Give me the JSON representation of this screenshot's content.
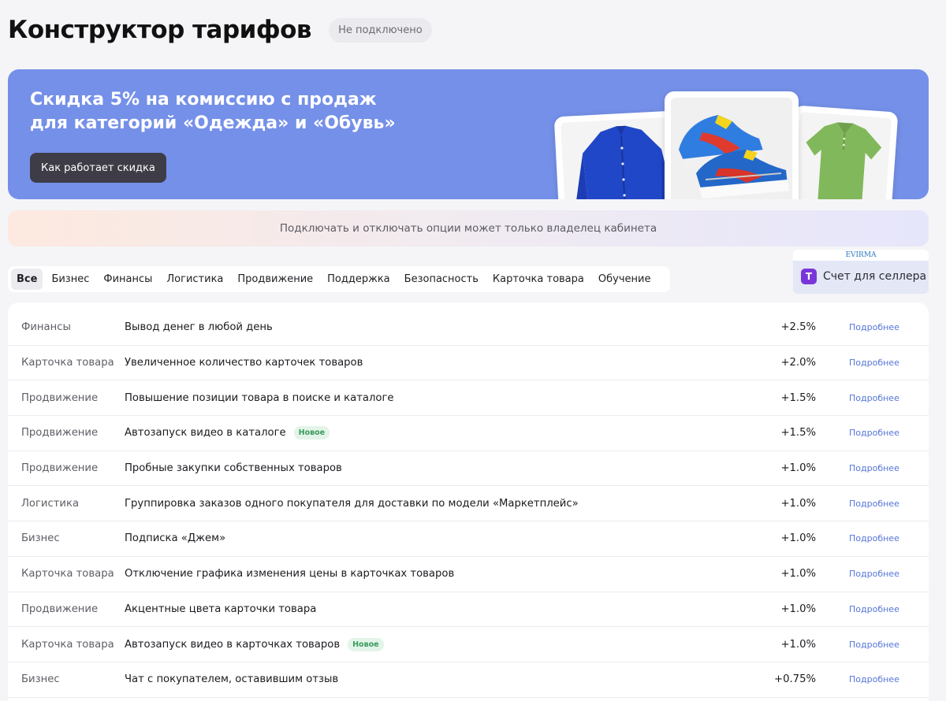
{
  "header": {
    "title": "Конструктор тарифов",
    "status": "Не подключено"
  },
  "banner": {
    "title_line1": "Скидка 5% на комиссию с продаж",
    "title_line2": "для категорий «Одежда» и «Обувь»",
    "button_label": "Как работает скидка",
    "background_color": "#7590e8"
  },
  "notice": {
    "text": "Подключать и отключать опции может только владелец кабинета"
  },
  "tabs": [
    {
      "label": "Все",
      "active": true
    },
    {
      "label": "Бизнес"
    },
    {
      "label": "Финансы"
    },
    {
      "label": "Логистика"
    },
    {
      "label": "Продвижение"
    },
    {
      "label": "Поддержка"
    },
    {
      "label": "Безопасность"
    },
    {
      "label": "Карточка товара"
    },
    {
      "label": "Обучение"
    }
  ],
  "seller": {
    "logo_text": "EVIRMA",
    "icon_letter": "T",
    "label": "Счет для селлера"
  },
  "options": [
    {
      "category": "Финансы",
      "name": "Вывод денег в любой день",
      "value": "+2.5%",
      "link": "Подробнее"
    },
    {
      "category": "Карточка товара",
      "name": "Увеличенное количество карточек товаров",
      "value": "+2.0%",
      "link": "Подробнее"
    },
    {
      "category": "Продвижение",
      "name": "Повышение позиции товара в поиске и каталоге",
      "value": "+1.5%",
      "link": "Подробнее"
    },
    {
      "category": "Продвижение",
      "name": "Автозапуск видео в каталоге",
      "badge": "Новое",
      "value": "+1.5%",
      "link": "Подробнее"
    },
    {
      "category": "Продвижение",
      "name": "Пробные закупки собственных товаров",
      "value": "+1.0%",
      "link": "Подробнее"
    },
    {
      "category": "Логистика",
      "name": "Группировка заказов одного покупателя для доставки по модели «Маркетплейс»",
      "value": "+1.0%",
      "link": "Подробнее"
    },
    {
      "category": "Бизнес",
      "name": "Подписка «Джем»",
      "value": "+1.0%",
      "link": "Подробнее"
    },
    {
      "category": "Карточка товара",
      "name": "Отключение графика изменения цены в карточках товаров",
      "value": "+1.0%",
      "link": "Подробнее"
    },
    {
      "category": "Продвижение",
      "name": "Акцентные цвета карточки товара",
      "value": "+1.0%",
      "link": "Подробнее"
    },
    {
      "category": "Карточка товара",
      "name": "Автозапуск видео в карточках товаров",
      "badge": "Новое",
      "value": "+1.0%",
      "link": "Подробнее"
    },
    {
      "category": "Бизнес",
      "name": "Чат с покупателем, оставившим отзыв",
      "value": "+0.75%",
      "link": "Подробнее"
    }
  ]
}
